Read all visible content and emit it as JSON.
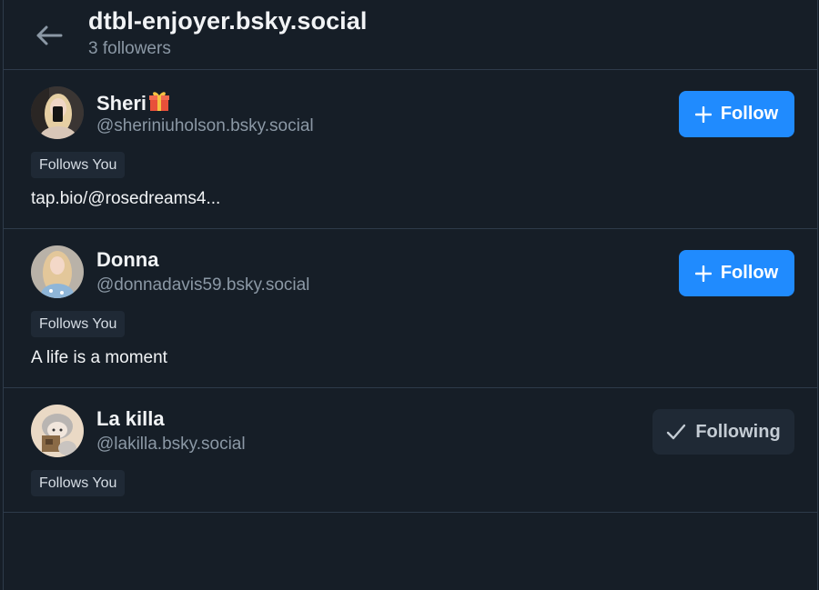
{
  "header": {
    "title": "dtbl-enjoyer.bsky.social",
    "subtitle": "3 followers",
    "back_icon": "arrow-left-icon"
  },
  "followers": [
    {
      "name": "Sheri",
      "name_emoji": "gift-icon",
      "handle": "@sheriniuholson.bsky.social",
      "badge": "Follows You",
      "bio": "tap.bio/@rosedreams4...",
      "button_label": "Follow",
      "button_icon": "plus-icon"
    },
    {
      "name": "Donna",
      "handle": "@donnadavis59.bsky.social",
      "badge": "Follows You",
      "bio": "A life is a moment",
      "button_label": "Follow",
      "button_icon": "plus-icon"
    },
    {
      "name": "La killa",
      "handle": "@lakilla.bsky.social",
      "badge": "Follows You",
      "bio": "",
      "button_label": "Following",
      "button_icon": "check-icon"
    }
  ],
  "colors": {
    "background": "#161e27",
    "border": "#2e3b4a",
    "primary": "#208bfe",
    "secondary_text": "#8b98a5",
    "badge_bg": "#1f2935"
  }
}
